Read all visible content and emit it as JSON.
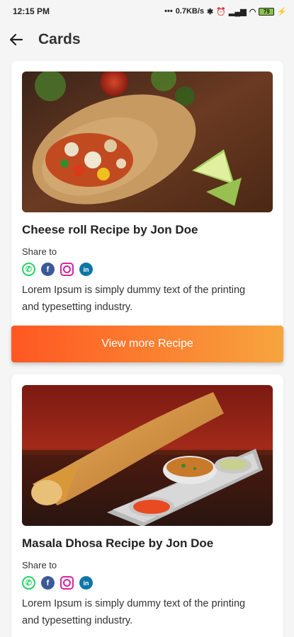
{
  "status": {
    "time": "12:15 PM",
    "speed": "0.7KB/s",
    "battery": "79"
  },
  "appbar": {
    "title": "Cards"
  },
  "cards": [
    {
      "title": "Cheese roll Recipe by Jon Doe",
      "share_label": "Share to",
      "description": "Lorem Ipsum is simply dummy text of the printing and typesetting industry.",
      "button_label": "View more Recipe"
    },
    {
      "title": "Masala Dhosa Recipe by Jon Doe",
      "share_label": "Share to",
      "description": "Lorem Ipsum is simply dummy text of the printing and typesetting industry."
    }
  ],
  "social_icons": [
    "whatsapp-icon",
    "facebook-icon",
    "instagram-icon",
    "linkedin-icon"
  ],
  "colors": {
    "button_start": "#ff5722",
    "button_end": "#f7a53e"
  }
}
